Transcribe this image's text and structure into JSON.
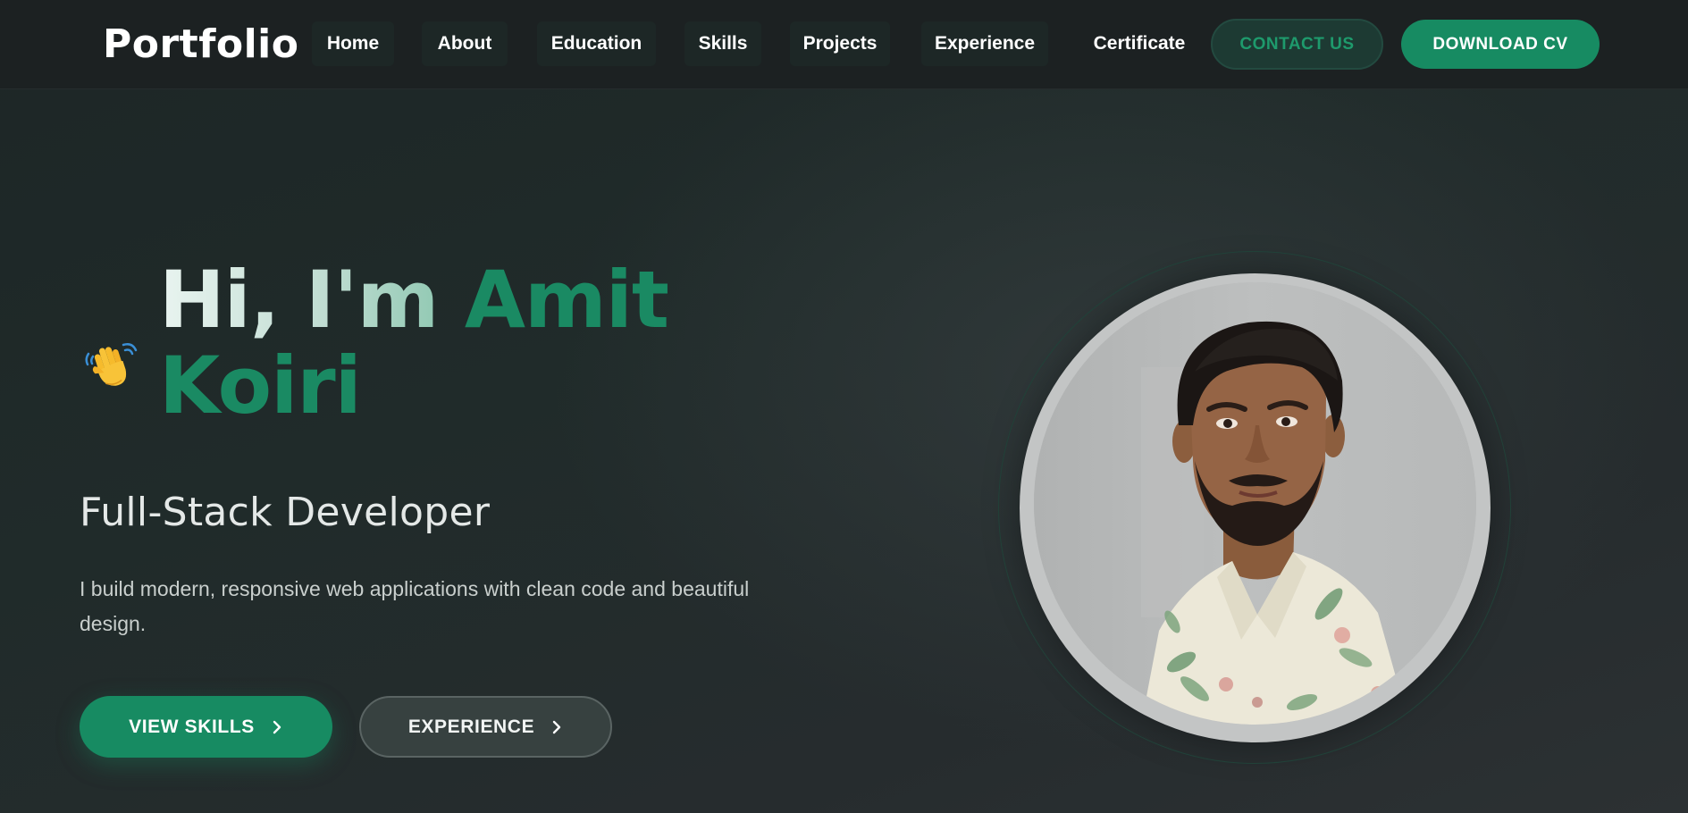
{
  "navbar": {
    "logo": "Portfolio",
    "items": [
      {
        "label": "Home"
      },
      {
        "label": "About"
      },
      {
        "label": "Education"
      },
      {
        "label": "Skills"
      },
      {
        "label": "Projects"
      },
      {
        "label": "Experience"
      },
      {
        "label": "Certificate"
      }
    ],
    "contact_label": "CONTACT US",
    "download_label": "DOWNLOAD CV"
  },
  "hero": {
    "wave_icon": "waving-hand-icon",
    "greeting": "Hi, I'm ",
    "name_first": "Amit",
    "name_last": "Koiri",
    "role": "Full-Stack Developer",
    "description": "I build modern, responsive web applications with clean code and beautiful design.",
    "buttons": {
      "skills_label": "VIEW SKILLS",
      "experience_label": "EXPERIENCE"
    }
  },
  "profile": {
    "image_icon": "profile-photo"
  },
  "colors": {
    "accent": "#178b62",
    "accent_text": "#1a8a63",
    "background": "#1f2626",
    "navbar": "#1c2122"
  }
}
